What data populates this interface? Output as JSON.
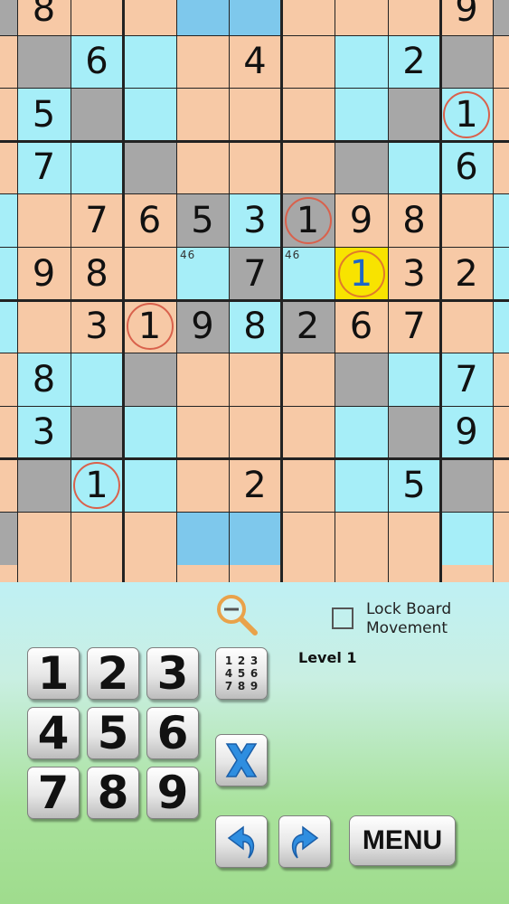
{
  "board": {
    "columns_visible": 11,
    "rows_visible": 11,
    "cells": [
      {
        "r": 0,
        "c": 0,
        "color": "gray"
      },
      {
        "r": 0,
        "c": 1,
        "v": "8"
      },
      {
        "r": 0,
        "c": 4,
        "color": "blue"
      },
      {
        "r": 0,
        "c": 5,
        "color": "blue"
      },
      {
        "r": 0,
        "c": 9,
        "v": "9"
      },
      {
        "r": 0,
        "c": 10,
        "color": "gray"
      },
      {
        "r": 1,
        "c": 1,
        "color": "gray"
      },
      {
        "r": 1,
        "c": 2,
        "v": "6",
        "color": "cyan"
      },
      {
        "r": 1,
        "c": 3,
        "color": "cyan"
      },
      {
        "r": 1,
        "c": 5,
        "v": "4"
      },
      {
        "r": 1,
        "c": 7,
        "color": "cyan"
      },
      {
        "r": 1,
        "c": 8,
        "v": "2",
        "color": "cyan"
      },
      {
        "r": 1,
        "c": 9,
        "color": "gray"
      },
      {
        "r": 2,
        "c": 1,
        "v": "5",
        "color": "cyan"
      },
      {
        "r": 2,
        "c": 2,
        "color": "gray"
      },
      {
        "r": 2,
        "c": 3,
        "color": "cyan"
      },
      {
        "r": 2,
        "c": 7,
        "color": "cyan"
      },
      {
        "r": 2,
        "c": 8,
        "color": "gray"
      },
      {
        "r": 2,
        "c": 9,
        "v": "1",
        "color": "cyan",
        "ring": true
      },
      {
        "r": 3,
        "c": 1,
        "v": "7",
        "color": "cyan"
      },
      {
        "r": 3,
        "c": 2,
        "color": "cyan"
      },
      {
        "r": 3,
        "c": 3,
        "color": "gray"
      },
      {
        "r": 3,
        "c": 7,
        "color": "gray"
      },
      {
        "r": 3,
        "c": 8,
        "color": "cyan"
      },
      {
        "r": 3,
        "c": 9,
        "v": "6",
        "color": "cyan"
      },
      {
        "r": 4,
        "c": 0,
        "color": "cyan"
      },
      {
        "r": 4,
        "c": 2,
        "v": "7"
      },
      {
        "r": 4,
        "c": 3,
        "v": "6"
      },
      {
        "r": 4,
        "c": 4,
        "v": "5",
        "color": "gray"
      },
      {
        "r": 4,
        "c": 5,
        "v": "3",
        "color": "cyan"
      },
      {
        "r": 4,
        "c": 6,
        "v": "1",
        "color": "gray",
        "ring": true
      },
      {
        "r": 4,
        "c": 7,
        "v": "9"
      },
      {
        "r": 4,
        "c": 8,
        "v": "8"
      },
      {
        "r": 4,
        "c": 10,
        "color": "cyan"
      },
      {
        "r": 5,
        "c": 0,
        "color": "cyan"
      },
      {
        "r": 5,
        "c": 1,
        "v": "9"
      },
      {
        "r": 5,
        "c": 2,
        "v": "8"
      },
      {
        "r": 5,
        "c": 4,
        "cand": "46",
        "color": "cyan"
      },
      {
        "r": 5,
        "c": 5,
        "v": "7",
        "color": "gray"
      },
      {
        "r": 5,
        "c": 6,
        "cand": "46",
        "color": "cyan"
      },
      {
        "r": 5,
        "c": 7,
        "v": "1",
        "color": "yellow",
        "selected": true
      },
      {
        "r": 5,
        "c": 8,
        "v": "3"
      },
      {
        "r": 5,
        "c": 9,
        "v": "2"
      },
      {
        "r": 5,
        "c": 10,
        "color": "cyan"
      },
      {
        "r": 6,
        "c": 0,
        "color": "cyan"
      },
      {
        "r": 6,
        "c": 2,
        "v": "3"
      },
      {
        "r": 6,
        "c": 3,
        "v": "1",
        "ring": true
      },
      {
        "r": 6,
        "c": 4,
        "v": "9",
        "color": "gray"
      },
      {
        "r": 6,
        "c": 5,
        "v": "8",
        "color": "cyan"
      },
      {
        "r": 6,
        "c": 6,
        "v": "2",
        "color": "gray"
      },
      {
        "r": 6,
        "c": 7,
        "v": "6"
      },
      {
        "r": 6,
        "c": 8,
        "v": "7"
      },
      {
        "r": 6,
        "c": 10,
        "color": "cyan"
      },
      {
        "r": 7,
        "c": 1,
        "v": "8",
        "color": "cyan"
      },
      {
        "r": 7,
        "c": 2,
        "color": "cyan"
      },
      {
        "r": 7,
        "c": 3,
        "color": "gray"
      },
      {
        "r": 7,
        "c": 7,
        "color": "gray"
      },
      {
        "r": 7,
        "c": 8,
        "color": "cyan"
      },
      {
        "r": 7,
        "c": 9,
        "v": "7",
        "color": "cyan"
      },
      {
        "r": 8,
        "c": 1,
        "v": "3",
        "color": "cyan"
      },
      {
        "r": 8,
        "c": 2,
        "color": "gray"
      },
      {
        "r": 8,
        "c": 3,
        "color": "cyan"
      },
      {
        "r": 8,
        "c": 7,
        "color": "cyan"
      },
      {
        "r": 8,
        "c": 8,
        "color": "gray"
      },
      {
        "r": 8,
        "c": 9,
        "v": "9",
        "color": "cyan"
      },
      {
        "r": 9,
        "c": 1,
        "color": "gray"
      },
      {
        "r": 9,
        "c": 2,
        "v": "1",
        "color": "cyan",
        "ring": true
      },
      {
        "r": 9,
        "c": 3,
        "color": "cyan"
      },
      {
        "r": 9,
        "c": 5,
        "v": "2"
      },
      {
        "r": 9,
        "c": 7,
        "color": "cyan"
      },
      {
        "r": 9,
        "c": 8,
        "v": "5",
        "color": "cyan"
      },
      {
        "r": 9,
        "c": 9,
        "color": "gray"
      },
      {
        "r": 10,
        "c": 0,
        "color": "gray"
      },
      {
        "r": 10,
        "c": 4,
        "color": "blue"
      },
      {
        "r": 10,
        "c": 5,
        "color": "blue"
      },
      {
        "r": 10,
        "c": 9,
        "color": "cyan"
      }
    ]
  },
  "colors": {
    "peach": "#f7c9a6",
    "cyan": "#a6eef8",
    "gray": "#a7a7a7",
    "blue": "#7ec8ec",
    "yellow": "#f8e300",
    "ring": "#d9614c",
    "selected_digit": "#1f66c8"
  },
  "panel": {
    "zoom_icon": "zoom-out-icon",
    "lock_label": "Lock Board Movement",
    "lock_checked": false,
    "level_label": "Level 1",
    "number_keys": [
      "1",
      "2",
      "3",
      "4",
      "5",
      "6",
      "7",
      "8",
      "9"
    ],
    "candidate_digits": [
      "1",
      "2",
      "3",
      "4",
      "5",
      "6",
      "7",
      "8",
      "9"
    ],
    "erase_icon": "x-erase-icon",
    "undo_icon": "undo-arrow-icon",
    "redo_icon": "redo-arrow-icon",
    "menu_label": "MENU"
  }
}
